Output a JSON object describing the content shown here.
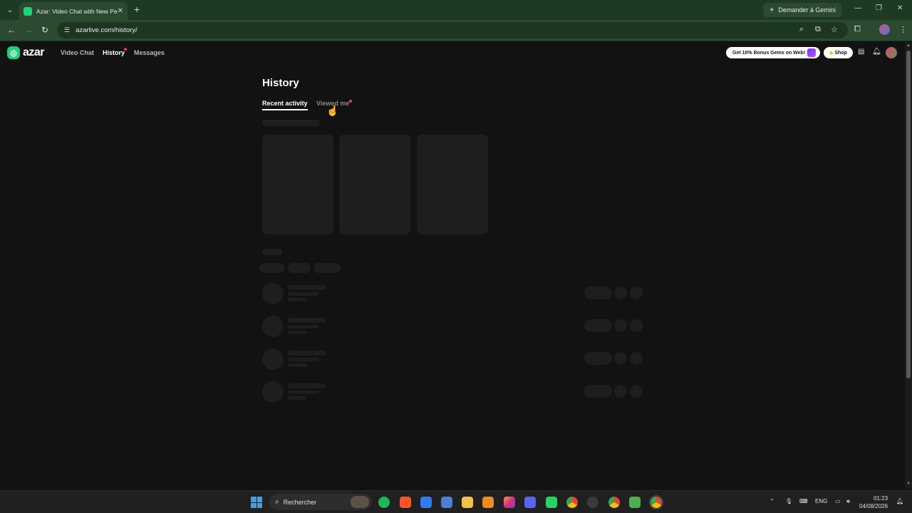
{
  "browser": {
    "tab_title": "Azar: Video Chat with New People",
    "url": "azarlive.com/history/",
    "gemini_label": "Demander à Gemini"
  },
  "site": {
    "logo_text": "azar",
    "nav": {
      "video_chat": "Video Chat",
      "history": "History",
      "messages": "Messages"
    },
    "promo_label": "Get 10% Bonus Gems on Web!",
    "shop_label": "Shop"
  },
  "main": {
    "title": "History",
    "tabs": {
      "recent": "Recent activity",
      "viewed": "Viewed me"
    }
  },
  "taskbar": {
    "search_placeholder": "Rechercher",
    "language": "ENG",
    "time": "01:23",
    "date": "04/08/2026"
  },
  "colors": {
    "brand": "#1fd17c",
    "notification": "#ff3b5c",
    "browser_frame": "#2b4a30"
  }
}
